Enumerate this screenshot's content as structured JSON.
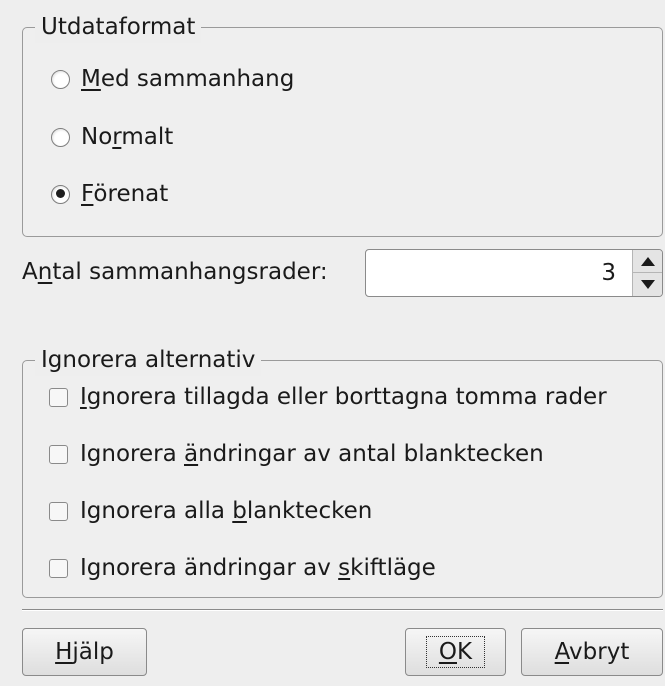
{
  "output_format": {
    "title": "Utdataformat",
    "options": [
      {
        "pre": "",
        "key": "M",
        "post": "ed sammanhang",
        "selected": false
      },
      {
        "pre": "No",
        "key": "r",
        "post": "malt",
        "selected": false
      },
      {
        "pre": "",
        "key": "F",
        "post": "örenat",
        "selected": true
      }
    ]
  },
  "context_lines": {
    "label_pre": "A",
    "label_key": "n",
    "label_post": "tal sammanhangsrader:",
    "value": "3"
  },
  "ignore": {
    "title": "Ignorera alternativ",
    "options": [
      {
        "pre": "",
        "key": "I",
        "post": "gnorera tillagda eller borttagna tomma rader",
        "checked": false
      },
      {
        "pre": "Ignorera ",
        "key": "ä",
        "post": "ndringar av antal blanktecken",
        "checked": false
      },
      {
        "pre": "Ignorera alla ",
        "key": "b",
        "post": "lanktecken",
        "checked": false
      },
      {
        "pre": "Ignorera ändringar av ",
        "key": "s",
        "post": "kiftläge",
        "checked": false
      }
    ]
  },
  "buttons": {
    "help": {
      "key": "H",
      "post": "jälp"
    },
    "ok": {
      "key": "O",
      "post": "K"
    },
    "cancel": {
      "key": "A",
      "post": "vbryt"
    }
  }
}
